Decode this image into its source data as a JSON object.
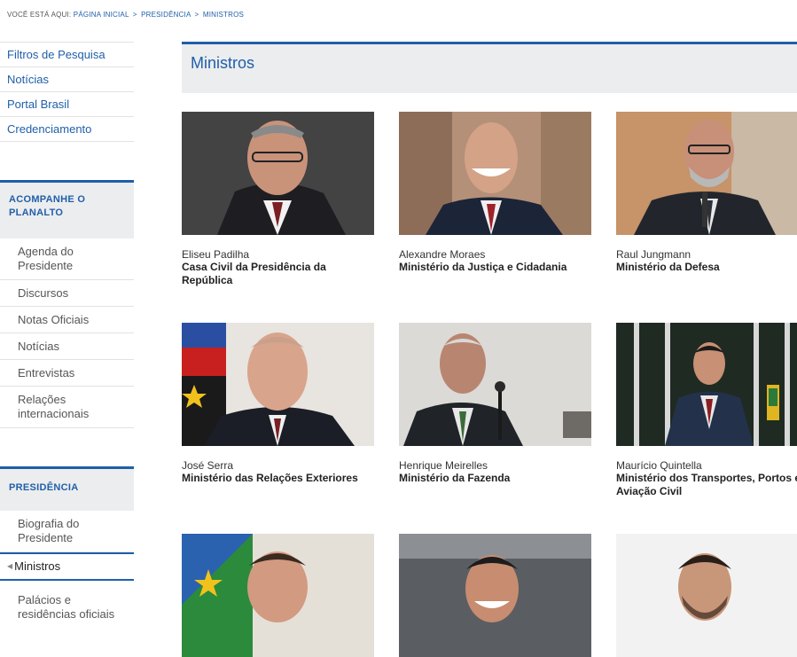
{
  "breadcrumb": {
    "prefix": "VOCÊ ESTÁ AQUI:",
    "home": "PÁGINA INICIAL",
    "sep": ">",
    "presidencia": "PRESIDÊNCIA",
    "current": "MINISTROS"
  },
  "sidebar": {
    "top_links": [
      "Filtros de Pesquisa",
      "Notícias",
      "Portal Brasil",
      "Credenciamento"
    ],
    "section1": {
      "title": "ACOMPANHE O PLANALTO",
      "items": [
        "Agenda do Presidente",
        "Discursos",
        "Notas Oficiais",
        "Notícias",
        "Entrevistas",
        "Relações internacionais"
      ]
    },
    "section2": {
      "title": "PRESIDÊNCIA",
      "items": [
        "Biografia do Presidente",
        "Ministros",
        "Palácios e residências oficiais"
      ]
    }
  },
  "main": {
    "title": "Ministros",
    "ministers": [
      {
        "name": "Eliseu Padilha",
        "ministry": "Casa Civil da Presidência da República"
      },
      {
        "name": "Alexandre Moraes",
        "ministry": "Ministério da Justiça e Cidadania"
      },
      {
        "name": "Raul Jungmann",
        "ministry": "Ministério da Defesa"
      },
      {
        "name": "José Serra",
        "ministry": "Ministério das Relações Exteriores"
      },
      {
        "name": "Henrique Meirelles",
        "ministry": "Ministério da Fazenda"
      },
      {
        "name": "Maurício Quintella",
        "ministry": "Ministério dos Transportes, Portos e Aviação Civil"
      },
      {
        "name": "",
        "ministry": ""
      },
      {
        "name": "",
        "ministry": ""
      },
      {
        "name": "",
        "ministry": ""
      }
    ]
  }
}
